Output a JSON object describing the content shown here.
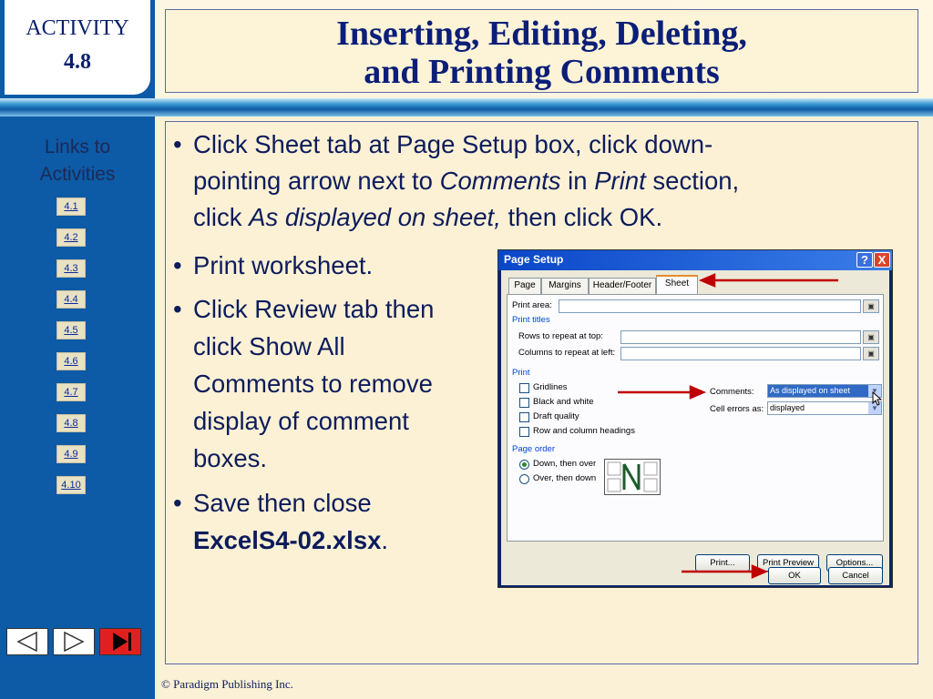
{
  "sidebar": {
    "activity_label": "ACTIVITY",
    "activity_number": "4.8",
    "links_title_line1": "Links to",
    "links_title_line2": "Activities",
    "links": [
      "4.1",
      "4.2",
      "4.3",
      "4.4",
      "4.5",
      "4.6",
      "4.7",
      "4.8",
      "4.9",
      "4.10"
    ]
  },
  "header": {
    "title_line1": "Inserting, Editing, Deleting,",
    "title_line2": "and Printing Comments"
  },
  "bullets": {
    "b1_l1": "Click Sheet tab at Page Setup box, click down-",
    "b1_l2_a": "pointing arrow next to ",
    "b1_l2_em1": "Comments",
    "b1_l2_b": " in ",
    "b1_l2_em2": "Print",
    "b1_l2_c": " section,",
    "b1_l3_a": "click ",
    "b1_l3_em": "As displayed on sheet,",
    "b1_l3_b": " then click OK.",
    "b2": "Print worksheet.",
    "b3_l1": "Click Review tab then",
    "b3_l2": "click Show All",
    "b3_l3": "Comments to remove",
    "b3_l4": "display of comment",
    "b3_l5": "boxes.",
    "b4_l1": "Save then close",
    "b4_l2_bold": "ExcelS4-02.xlsx",
    "b4_l2_end": ".",
    "dot": "•"
  },
  "dialog": {
    "title": "Page Setup",
    "help_btn": "?",
    "close_btn": "X",
    "tabs": [
      "Page",
      "Margins",
      "Header/Footer",
      "Sheet"
    ],
    "print_area_label": "Print area:",
    "print_titles_group": "Print titles",
    "rows_label": "Rows to repeat at top:",
    "columns_label": "Columns to repeat at left:",
    "print_group": "Print",
    "gridlines": "Gridlines",
    "black_white": "Black and white",
    "draft_quality": "Draft quality",
    "row_col_headings": "Row and column headings",
    "comments_label": "Comments:",
    "comments_value": "As displayed on sheet",
    "cell_errors_label": "Cell errors as:",
    "cell_errors_value": "displayed",
    "page_order_group": "Page order",
    "down_then_over": "Down, then over",
    "over_then_down": "Over, then down",
    "print_btn": "Print...",
    "print_preview_btn": "Print Preview",
    "options_btn": "Options...",
    "ok_btn": "OK",
    "cancel_btn": "Cancel"
  },
  "footer": {
    "copyright": "© Paradigm Publishing Inc."
  },
  "colors": {
    "sidebar": "#0d5aa6",
    "title_text": "#0b1e78",
    "body_text": "#0d1c5c",
    "arrow": "#c00000",
    "tab_accent": "#e68b2c"
  }
}
